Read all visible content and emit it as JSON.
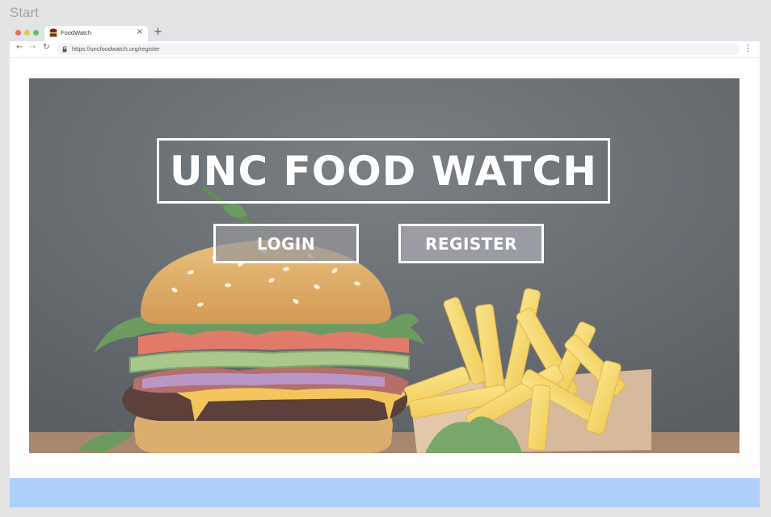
{
  "frame": {
    "label": "Start"
  },
  "browser": {
    "tab_title": "FoodWatch",
    "tab_close": "×",
    "new_tab": "+",
    "url": "https://uncfoodwatch.org/register",
    "back": "←",
    "forward": "→",
    "reload": "↻",
    "menu": "⋮"
  },
  "hero": {
    "title": "UNC FOOD WATCH",
    "login_label": "LOGIN",
    "register_label": "REGISTER"
  },
  "colors": {
    "hero_background": "#646a70",
    "footer_bar": "#aed0fa",
    "button_border": "#ffffff"
  }
}
